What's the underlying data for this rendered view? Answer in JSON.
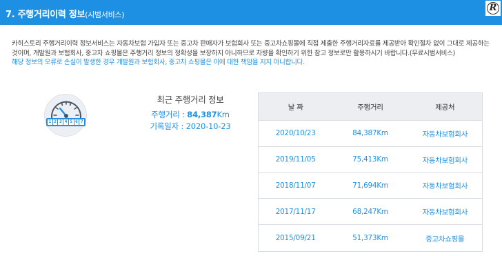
{
  "header": {
    "title": "7. 주행거리이력 정보",
    "subtitle": "(시범서비스)",
    "logo_letter": "R"
  },
  "description": {
    "line1": "카히스토리 주행거리이력 정보서비스는 자동차보험 가입자 또는 중고차 판매자가 보험회사 또는 중고차쇼핑몰에 직접 제출한 주행거리자료를 제공받아 확인절차 없이 그대로 제공하는",
    "line2": "것이며, 개발원과 보험회사, 중고차 쇼핑몰은 주행거리 정보의 정확성을 보장하지 아니하므로 차량을 확인하기 위한 참고 정보로만 활용하시기 바랍니다.(무료시범서비스)",
    "warning": "해당 정보의 오류로 손실이 발생한 경우 개발원과 보험회사, 중고차 쇼핑몰은 이에 대한 책임을 지지 아니합니다."
  },
  "gauge": {
    "icon": "odometer-gauge-icon",
    "digits": [
      "1",
      "2",
      "3",
      "4",
      "5",
      "6",
      "7"
    ]
  },
  "recent": {
    "title": "최근 주행거리 정보",
    "mileage_label": "주행거리 : ",
    "mileage_value": "84,387",
    "mileage_unit": "Km",
    "date_label": "기록일자 : ",
    "date_value": "2020-10-23"
  },
  "table": {
    "headers": [
      "날 짜",
      "주행거리",
      "제공처"
    ],
    "rows": [
      [
        "2020/10/23",
        "84,387Km",
        "자동차보험회사"
      ],
      [
        "2019/11/05",
        "75,413Km",
        "자동차보험회사"
      ],
      [
        "2018/11/07",
        "71,694Km",
        "자동차보험회사"
      ],
      [
        "2017/11/17",
        "68,247Km",
        "자동차보험회사"
      ],
      [
        "2015/09/21",
        "51,373Km",
        "중고차쇼핑몰"
      ]
    ]
  },
  "colors": {
    "accent": "#1e90e4",
    "table_header_bg": "#eceef1"
  }
}
